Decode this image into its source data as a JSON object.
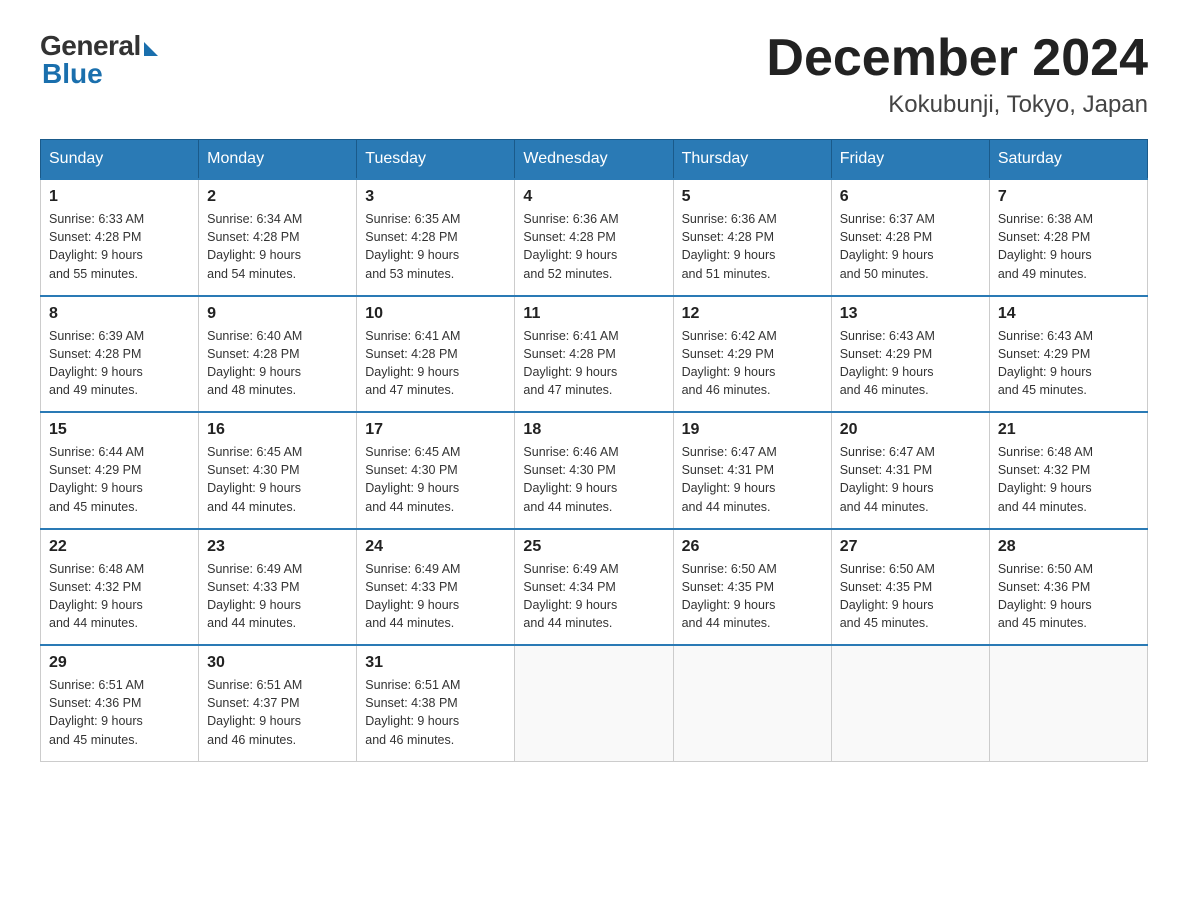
{
  "header": {
    "logo_general": "General",
    "logo_blue": "Blue",
    "month_title": "December 2024",
    "location": "Kokubunji, Tokyo, Japan"
  },
  "weekdays": [
    "Sunday",
    "Monday",
    "Tuesday",
    "Wednesday",
    "Thursday",
    "Friday",
    "Saturday"
  ],
  "weeks": [
    [
      {
        "day": "1",
        "sunrise": "6:33 AM",
        "sunset": "4:28 PM",
        "daylight": "9 hours and 55 minutes."
      },
      {
        "day": "2",
        "sunrise": "6:34 AM",
        "sunset": "4:28 PM",
        "daylight": "9 hours and 54 minutes."
      },
      {
        "day": "3",
        "sunrise": "6:35 AM",
        "sunset": "4:28 PM",
        "daylight": "9 hours and 53 minutes."
      },
      {
        "day": "4",
        "sunrise": "6:36 AM",
        "sunset": "4:28 PM",
        "daylight": "9 hours and 52 minutes."
      },
      {
        "day": "5",
        "sunrise": "6:36 AM",
        "sunset": "4:28 PM",
        "daylight": "9 hours and 51 minutes."
      },
      {
        "day": "6",
        "sunrise": "6:37 AM",
        "sunset": "4:28 PM",
        "daylight": "9 hours and 50 minutes."
      },
      {
        "day": "7",
        "sunrise": "6:38 AM",
        "sunset": "4:28 PM",
        "daylight": "9 hours and 49 minutes."
      }
    ],
    [
      {
        "day": "8",
        "sunrise": "6:39 AM",
        "sunset": "4:28 PM",
        "daylight": "9 hours and 49 minutes."
      },
      {
        "day": "9",
        "sunrise": "6:40 AM",
        "sunset": "4:28 PM",
        "daylight": "9 hours and 48 minutes."
      },
      {
        "day": "10",
        "sunrise": "6:41 AM",
        "sunset": "4:28 PM",
        "daylight": "9 hours and 47 minutes."
      },
      {
        "day": "11",
        "sunrise": "6:41 AM",
        "sunset": "4:28 PM",
        "daylight": "9 hours and 47 minutes."
      },
      {
        "day": "12",
        "sunrise": "6:42 AM",
        "sunset": "4:29 PM",
        "daylight": "9 hours and 46 minutes."
      },
      {
        "day": "13",
        "sunrise": "6:43 AM",
        "sunset": "4:29 PM",
        "daylight": "9 hours and 46 minutes."
      },
      {
        "day": "14",
        "sunrise": "6:43 AM",
        "sunset": "4:29 PM",
        "daylight": "9 hours and 45 minutes."
      }
    ],
    [
      {
        "day": "15",
        "sunrise": "6:44 AM",
        "sunset": "4:29 PM",
        "daylight": "9 hours and 45 minutes."
      },
      {
        "day": "16",
        "sunrise": "6:45 AM",
        "sunset": "4:30 PM",
        "daylight": "9 hours and 44 minutes."
      },
      {
        "day": "17",
        "sunrise": "6:45 AM",
        "sunset": "4:30 PM",
        "daylight": "9 hours and 44 minutes."
      },
      {
        "day": "18",
        "sunrise": "6:46 AM",
        "sunset": "4:30 PM",
        "daylight": "9 hours and 44 minutes."
      },
      {
        "day": "19",
        "sunrise": "6:47 AM",
        "sunset": "4:31 PM",
        "daylight": "9 hours and 44 minutes."
      },
      {
        "day": "20",
        "sunrise": "6:47 AM",
        "sunset": "4:31 PM",
        "daylight": "9 hours and 44 minutes."
      },
      {
        "day": "21",
        "sunrise": "6:48 AM",
        "sunset": "4:32 PM",
        "daylight": "9 hours and 44 minutes."
      }
    ],
    [
      {
        "day": "22",
        "sunrise": "6:48 AM",
        "sunset": "4:32 PM",
        "daylight": "9 hours and 44 minutes."
      },
      {
        "day": "23",
        "sunrise": "6:49 AM",
        "sunset": "4:33 PM",
        "daylight": "9 hours and 44 minutes."
      },
      {
        "day": "24",
        "sunrise": "6:49 AM",
        "sunset": "4:33 PM",
        "daylight": "9 hours and 44 minutes."
      },
      {
        "day": "25",
        "sunrise": "6:49 AM",
        "sunset": "4:34 PM",
        "daylight": "9 hours and 44 minutes."
      },
      {
        "day": "26",
        "sunrise": "6:50 AM",
        "sunset": "4:35 PM",
        "daylight": "9 hours and 44 minutes."
      },
      {
        "day": "27",
        "sunrise": "6:50 AM",
        "sunset": "4:35 PM",
        "daylight": "9 hours and 45 minutes."
      },
      {
        "day": "28",
        "sunrise": "6:50 AM",
        "sunset": "4:36 PM",
        "daylight": "9 hours and 45 minutes."
      }
    ],
    [
      {
        "day": "29",
        "sunrise": "6:51 AM",
        "sunset": "4:36 PM",
        "daylight": "9 hours and 45 minutes."
      },
      {
        "day": "30",
        "sunrise": "6:51 AM",
        "sunset": "4:37 PM",
        "daylight": "9 hours and 46 minutes."
      },
      {
        "day": "31",
        "sunrise": "6:51 AM",
        "sunset": "4:38 PM",
        "daylight": "9 hours and 46 minutes."
      },
      null,
      null,
      null,
      null
    ]
  ],
  "labels": {
    "sunrise": "Sunrise:",
    "sunset": "Sunset:",
    "daylight": "Daylight:"
  }
}
